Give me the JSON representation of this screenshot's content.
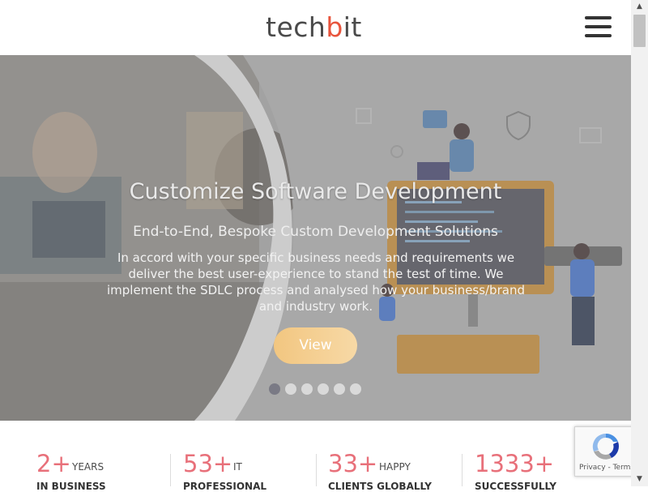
{
  "header": {
    "logo_part1": "tech",
    "logo_accent": "b",
    "logo_part2": "it",
    "menu_icon": "hamburger-menu-icon"
  },
  "hero": {
    "title": "Customize Software Development",
    "subtitle": "End-to-End, Bespoke Custom Development Solutions",
    "description": "In accord with your specific business needs and requirements we deliver the best user-experience to stand the test of time. We implement the SDLC process and analysed how your business/brand and industry work.",
    "button_label": "View",
    "slides_total": 6,
    "active_slide": 1
  },
  "stats": [
    {
      "number": "2+",
      "word": "YEARS",
      "line2": "IN BUSINESS"
    },
    {
      "number": "53+",
      "word": "IT",
      "line2": "PROFESSIONAL"
    },
    {
      "number": "33+",
      "word": "HAPPY",
      "line2": "CLIENTS GLOBALLY"
    },
    {
      "number": "1333+",
      "word": "",
      "line2": "SUCCESSFULLY"
    }
  ],
  "recaptcha": {
    "privacy_label": "Privacy",
    "separator": " - ",
    "terms_label": "Terms"
  },
  "colors": {
    "accent": "#e8543c",
    "stat_number": "#e8707a",
    "button": "#f2c680",
    "dot_active": "#7a7a85",
    "dot_inactive": "#d9d9d9"
  }
}
